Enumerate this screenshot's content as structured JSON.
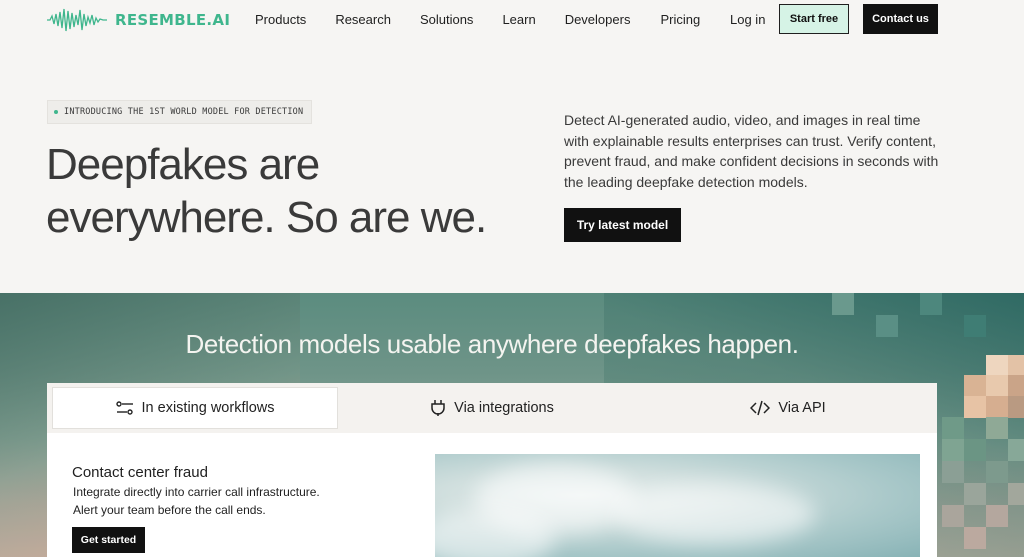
{
  "brand": {
    "name": "RESEMBLE.AI",
    "color": "#3fb68d"
  },
  "nav": {
    "links": [
      "Products",
      "Research",
      "Solutions",
      "Learn",
      "Developers",
      "Pricing"
    ],
    "login": "Log in",
    "start_free": "Start free",
    "contact": "Contact us"
  },
  "hero": {
    "badge": "INTRODUCING THE 1ST WORLD MODEL FOR DETECTION",
    "title": "Deepfakes are everywhere. So are we.",
    "description": "Detect AI-generated audio, video, and images in real time with explainable results enterprises can trust. Verify content, prevent fraud, and make confident decisions in seconds with the leading deepfake detection models.",
    "cta": "Try latest model"
  },
  "section": {
    "title": "Detection models usable anywhere deepfakes happen.",
    "tabs": [
      {
        "label": "In existing workflows",
        "icon": "workflow-icon",
        "active": true
      },
      {
        "label": "Via integrations",
        "icon": "plug-icon",
        "active": false
      },
      {
        "label": "Via API",
        "icon": "code-icon",
        "active": false
      }
    ],
    "feature": {
      "title": "Contact center fraud",
      "line1": "Integrate directly into carrier call infrastructure.",
      "line2": "Alert your team before the call ends.",
      "cta": "Get started"
    }
  }
}
